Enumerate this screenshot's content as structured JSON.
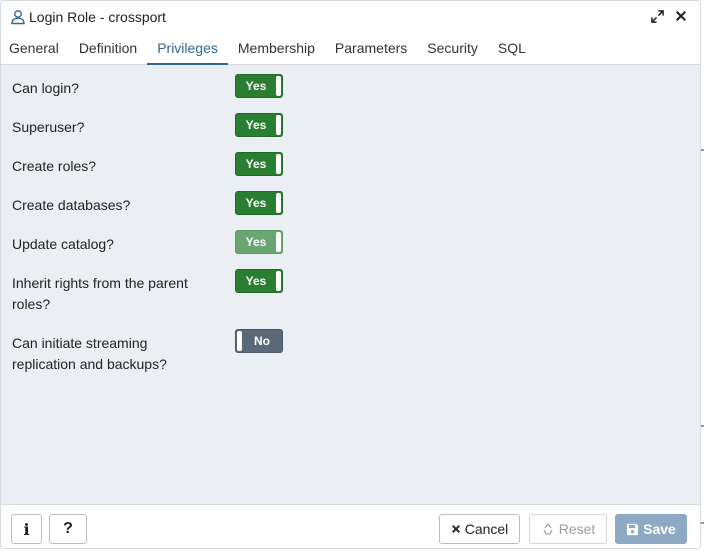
{
  "window": {
    "title": "Login Role - crossport"
  },
  "tabs": [
    {
      "label": "General"
    },
    {
      "label": "Definition"
    },
    {
      "label": "Privileges",
      "active": true
    },
    {
      "label": "Membership"
    },
    {
      "label": "Parameters"
    },
    {
      "label": "Security"
    },
    {
      "label": "SQL"
    }
  ],
  "privileges": [
    {
      "label": "Can login?",
      "value": "Yes"
    },
    {
      "label": "Superuser?",
      "value": "Yes"
    },
    {
      "label": "Create roles?",
      "value": "Yes"
    },
    {
      "label": "Create databases?",
      "value": "Yes"
    },
    {
      "label": "Update catalog?",
      "value": "Yes",
      "disabled": true
    },
    {
      "label": "Inherit rights from the parent roles?",
      "value": "Yes"
    },
    {
      "label": "Can initiate streaming replication and backups?",
      "value": "No"
    }
  ],
  "footer": {
    "info_label": "i",
    "help_label": "?",
    "cancel_label": "Cancel",
    "reset_label": "Reset",
    "save_label": "Save"
  },
  "colors": {
    "toggle_on": "#2a7e32",
    "toggle_off": "#5b6878",
    "accent": "#326690",
    "save_button": "#8ea9c4"
  }
}
